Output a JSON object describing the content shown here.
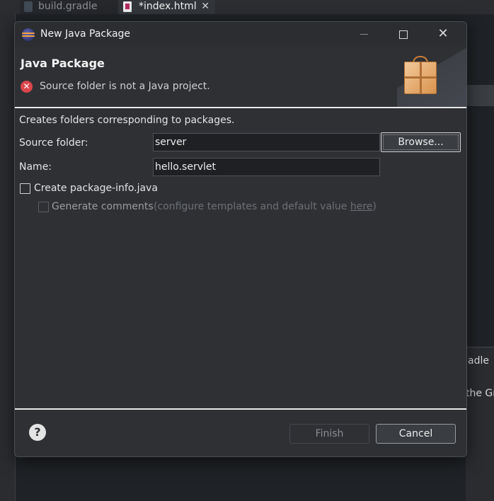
{
  "ide": {
    "tabs": [
      {
        "label": "build.gradle"
      },
      {
        "label": "*index.html",
        "close": "✕"
      }
    ],
    "peek_texts": [
      "adle",
      "the Gr"
    ]
  },
  "dialog": {
    "title": "New Java Package",
    "window_controls": {
      "close": "✕"
    },
    "banner": {
      "heading": "Java Package",
      "error_icon": "✕",
      "error_message": "Source folder is not a Java project."
    },
    "description": "Creates folders corresponding to packages.",
    "source_folder": {
      "label": "Source folder:",
      "value": "server",
      "browse_label": "Browse..."
    },
    "name": {
      "label": "Name:",
      "value": "hello.servlet"
    },
    "create_package_info": {
      "label": "Create package-info.java",
      "checked": false
    },
    "generate_comments": {
      "label": "Generate comments",
      "checked": false,
      "hint_prefix": "(configure templates and default value ",
      "hint_link": "here",
      "hint_suffix": ")"
    },
    "footer": {
      "help_icon": "?",
      "finish_label": "Finish",
      "cancel_label": "Cancel"
    }
  },
  "colors": {
    "background": "#1f2226",
    "dialog_bg": "#2e3034",
    "error": "#d9464c"
  },
  "icons": [
    "eclipse-icon",
    "error-icon",
    "package-icon",
    "help-icon",
    "close-icon",
    "maximize-icon",
    "minimize-icon"
  ]
}
